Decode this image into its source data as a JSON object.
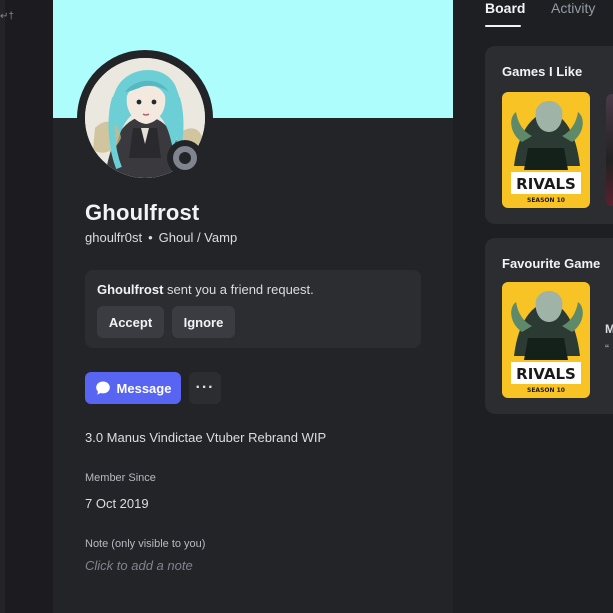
{
  "left_strip": {
    "glyph": "↵†"
  },
  "profile": {
    "display_name": "Ghoulfrost",
    "username": "ghoulfr0st",
    "separator": "•",
    "pronouns": "Ghoul / Vamp",
    "status_icon": "offline-status",
    "friend_request": {
      "sender": "Ghoulfrost",
      "message": " sent you a friend request.",
      "accept_label": "Accept",
      "ignore_label": "Ignore"
    },
    "actions": {
      "message_label": "Message",
      "more_label": "···"
    },
    "bio": "3.0 Manus Vindictae Vtuber Rebrand WIP",
    "member_since": {
      "label": "Member Since",
      "value": "7 Oct 2019"
    },
    "note": {
      "label": "Note (only visible to you)",
      "placeholder": "Click to add a note"
    }
  },
  "right_panel": {
    "tabs": [
      {
        "label": "Board"
      },
      {
        "label": "Activity"
      }
    ],
    "games_i_like": {
      "title": "Games I Like",
      "cover_logo": "RIVALS",
      "cover_subtitle": "SEASON 10"
    },
    "favourite_game": {
      "title": "Favourite Game",
      "cover_logo": "RIVALS",
      "cover_subtitle": "SEASON 10",
      "name_partial": "M",
      "quote_partial": "“"
    }
  },
  "colors": {
    "banner": "#adfdfd",
    "accent": "#5865f2",
    "card_bg": "#2b2d31",
    "panel_bg": "#232428",
    "status_offline": "#80848e",
    "cover_yellow": "#f7c325"
  }
}
